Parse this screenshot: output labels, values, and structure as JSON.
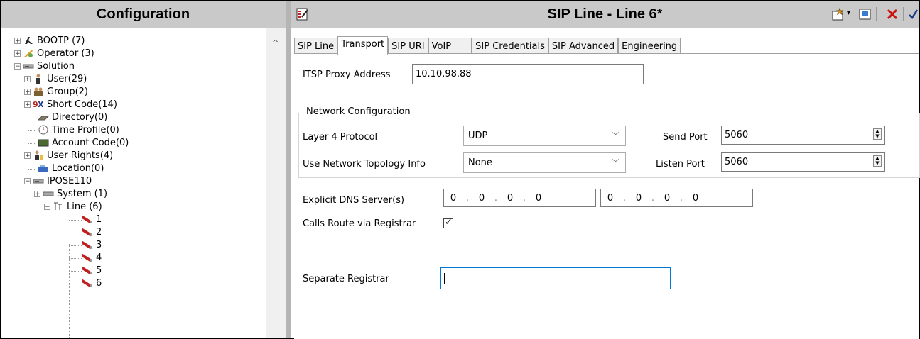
{
  "left_panel": {
    "title": "Configuration",
    "tree": [
      {
        "label": "BOOTP (7)",
        "icon": "bootp-icon"
      },
      {
        "label": "Operator (3)",
        "icon": "operator-icon"
      },
      {
        "label": "Solution",
        "icon": "solution-icon"
      },
      {
        "label": "User(29)",
        "icon": "user-icon"
      },
      {
        "label": "Group(2)",
        "icon": "group-icon"
      },
      {
        "label": "Short Code(14)",
        "icon": "short-code-icon"
      },
      {
        "label": "Directory(0)",
        "icon": "directory-icon"
      },
      {
        "label": "Time Profile(0)",
        "icon": "time-profile-icon"
      },
      {
        "label": "Account Code(0)",
        "icon": "account-code-icon"
      },
      {
        "label": "User Rights(4)",
        "icon": "user-rights-icon"
      },
      {
        "label": "Location(0)",
        "icon": "location-icon"
      },
      {
        "label": "IPOSE110",
        "icon": "ipose-icon"
      },
      {
        "label": "System (1)",
        "icon": "system-icon"
      },
      {
        "label": "Line (6)",
        "icon": "line-icon"
      },
      {
        "label": "1",
        "icon": "line-item-icon"
      },
      {
        "label": "2",
        "icon": "line-item-icon"
      },
      {
        "label": "3",
        "icon": "line-item-icon"
      },
      {
        "label": "4",
        "icon": "line-item-icon"
      },
      {
        "label": "5",
        "icon": "line-item-icon"
      },
      {
        "label": "6",
        "icon": "line-item-icon"
      }
    ]
  },
  "right_panel": {
    "title": "SIP Line - Line 6*",
    "tabs": [
      {
        "label": "SIP Line"
      },
      {
        "label": "Transport"
      },
      {
        "label": "SIP URI"
      },
      {
        "label": "VoIP"
      },
      {
        "label": "SIP Credentials"
      },
      {
        "label": "SIP Advanced"
      },
      {
        "label": "Engineering"
      }
    ],
    "active_tab": "Transport",
    "itsp_proxy_label": "ITSP Proxy Address",
    "itsp_proxy_value": "10.10.98.88",
    "network_group_title": "Network Configuration",
    "layer4_label": "Layer 4 Protocol",
    "layer4_value": "UDP",
    "topology_label": "Use Network Topology Info",
    "topology_value": "None",
    "send_port_label": "Send Port",
    "send_port_value": "5060",
    "listen_port_label": "Listen Port",
    "listen_port_value": "5060",
    "dns_label": "Explicit DNS Server(s)",
    "dns1": [
      "0",
      "0",
      "0",
      "0"
    ],
    "dns2": [
      "0",
      "0",
      "0",
      "0"
    ],
    "calls_route_label": "Calls Route via Registrar",
    "calls_route_checked": true,
    "separate_registrar_label": "Separate Registrar",
    "separate_registrar_value": ""
  },
  "colors": {
    "header_bg": "#c9c9c9",
    "accent_blue": "#0078d7",
    "close_red": "#cc1010"
  }
}
